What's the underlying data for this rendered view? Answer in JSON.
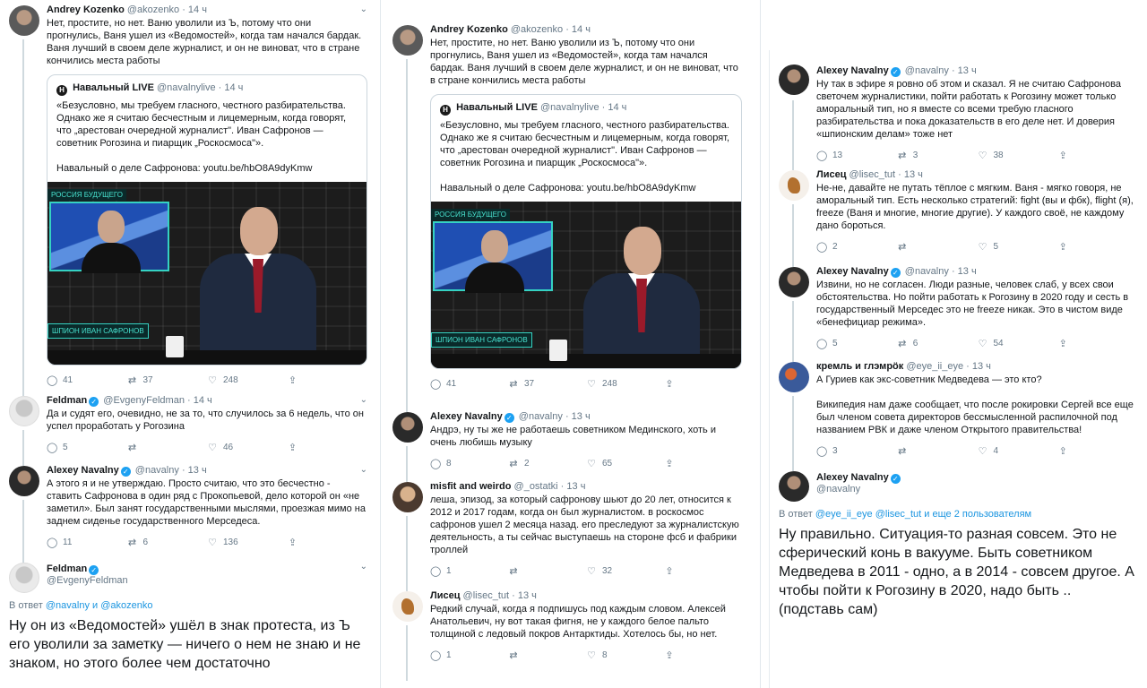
{
  "col1": {
    "t1": {
      "name": "Andrey Kozenko",
      "handle": "@akozenko",
      "time": "14 ч",
      "text": "Нет, простите, но нет. Ваню уволили из Ъ, потому что они прогнулись, Ваня ушел из «Ведомостей», когда там начался бардак. Ваня лучший в своем деле журналист, и он не виноват, что в стране кончились места работы",
      "quote": {
        "logo": "Н",
        "name": "Навальный LIVE",
        "handle": "@navalnylive",
        "time": "14 ч",
        "text": "«Безусловно, мы требуем гласного, честного разбирательства. Однако же я считаю бесчестным и лицемерным, когда говорят, что „арестован очередной журналист\". Иван Сафронов — советник Рогозина и пиарщик „Роскосмоса\"».\n\nНавальный о деле Сафронова: youtu.be/hbO8A9dyKmw",
        "img_tag": "РОССИЯ БУДУЩЕГО",
        "img_caption": "ШПИОН ИВАН САФРОНОВ"
      },
      "replies": "41",
      "retweets": "37",
      "likes": "248"
    },
    "t2": {
      "name": "Feldman",
      "handle": "@EvgenyFeldman",
      "time": "14 ч",
      "text": "Да и судят его, очевидно, не за то, что случилось за 6 недель, что он успел проработать у Рогозина",
      "replies": "5",
      "retweets": "",
      "likes": "46"
    },
    "t3": {
      "name": "Alexey Navalny",
      "handle": "@navalny",
      "time": "13 ч",
      "text": "А этого я и не утверждаю. Просто считаю, что это бесчестно - ставить Сафронова в один ряд с Прокопьевой, дело которой он «не заметил». Был занят государственными мыслями, проезжая мимо на заднем сиденье государственного Мерседеса.",
      "replies": "11",
      "retweets": "6",
      "likes": "136"
    },
    "t4": {
      "name": "Feldman",
      "handle": "@EvgenyFeldman",
      "reply_prefix": "В ответ",
      "reply_to": "@navalny и @akozenko",
      "text": "Ну он из «Ведомостей» ушёл в знак протеста, из Ъ его уволили за заметку — ничего о нем не знаю и не знаком, но этого более чем достаточно"
    }
  },
  "col2": {
    "t1": {
      "name": "Andrey Kozenko",
      "handle": "@akozenko",
      "time": "14 ч",
      "text": "Нет, простите, но нет. Ваню уволили из Ъ, потому что они прогнулись, Ваня ушел из «Ведомостей», когда там начался бардак. Ваня лучший в своем деле журналист, и он не виноват, что в стране кончились места работы",
      "quote": {
        "logo": "Н",
        "name": "Навальный LIVE",
        "handle": "@navalnylive",
        "time": "14 ч",
        "text": "«Безусловно, мы требуем гласного, честного разбирательства. Однако же я считаю бесчестным и лицемерным, когда говорят, что „арестован очередной журналист\". Иван Сафронов — советник Рогозина и пиарщик „Роскосмоса\"».\n\nНавальный о деле Сафронова: youtu.be/hbO8A9dyKmw",
        "img_tag": "РОССИЯ БУДУЩЕГО",
        "img_caption": "ШПИОН ИВАН САФРОНОВ"
      },
      "replies": "41",
      "retweets": "37",
      "likes": "248"
    },
    "t2": {
      "name": "Alexey Navalny",
      "handle": "@navalny",
      "time": "13 ч",
      "text": "Андрэ, ну ты же не работаешь советником Мединского, хоть и очень любишь музыку",
      "replies": "8",
      "retweets": "2",
      "likes": "65"
    },
    "t3": {
      "name": "misfit and weirdo",
      "handle": "@_ostatki",
      "time": "13 ч",
      "text": "леша, эпизод, за который сафронову шьют до 20 лет, относится к 2012 и 2017 годам, когда он был журналистом. в роскосмос сафронов ушел 2 месяца назад. его преследуют за журналистскую деятельность, а ты сейчас выступаешь на стороне фсб и фабрики троллей",
      "replies": "1",
      "retweets": "",
      "likes": "32"
    },
    "t4": {
      "name": "Лисец",
      "handle": "@lisec_tut",
      "time": "13 ч",
      "text": "Редкий случай, когда я подпишусь под каждым словом. Алексей Анатольевич, ну вот такая фигня, не у каждого белое пальто толщиной с ледовый покров Антарктиды. Хотелось бы, но нет.",
      "replies": "1",
      "retweets": "",
      "likes": "8"
    }
  },
  "col3": {
    "t1": {
      "name": "Alexey Navalny",
      "handle": "@navalny",
      "time": "13 ч",
      "text": "Ну так в эфире я ровно об этом и сказал. Я не считаю Сафронова светочем журналистики, пойти работать к Рогозину может только аморальный тип, но я вместе со всеми требую гласного разбирательства и пока доказательств в его деле нет. И доверия «шпионским делам» тоже нет",
      "replies": "13",
      "retweets": "3",
      "likes": "38"
    },
    "t2": {
      "name": "Лисец",
      "handle": "@lisec_tut",
      "time": "13 ч",
      "text": "Не-не, давайте не путать тёплое с мягким. Ваня - мягко говоря, не аморальный тип. Есть несколько стратегий: fight (вы и фбк), flight (я), freeze (Ваня и многие, многие другие). У каждого своё, не каждому дано бороться.",
      "replies": "2",
      "retweets": "",
      "likes": "5"
    },
    "t3": {
      "name": "Alexey Navalny",
      "handle": "@navalny",
      "time": "13 ч",
      "text": "Извини, но не согласен. Люди разные, человек слаб, у всех свои обстоятельства. Но пойти работать к Рогозину в 2020 году и сесть в государственный Мерседес это не freeze никак. Это в чистом виде «бенефициар режима».",
      "replies": "5",
      "retweets": "6",
      "likes": "54"
    },
    "t4": {
      "name": "кремль и глэмрöк",
      "handle": "@eye_ii_eye",
      "time": "13 ч",
      "text": "А Гуриев как экс-советник Медведева — это кто?\n\nВикипедия нам даже сообщает, что после рокировки Сергей все еще был членом совета директоров бессмысленной распилочной под названием РВК и даже членом Открытого правительства!",
      "replies": "3",
      "retweets": "",
      "likes": "4"
    },
    "t5": {
      "name": "Alexey Navalny",
      "handle": "@navalny",
      "reply_prefix": "В ответ",
      "reply_to": "@eye_ii_eye @lisec_tut и еще 2 пользователям",
      "text": "Ну правильно. Ситуация-то разная совсем. Это не сферический конь в вакууме. Быть советником Медведева в 2011 - одно, а в 2014 - совсем другое. А чтобы пойти к Рогозину в 2020, надо быть .. (подставь сам)"
    }
  },
  "icons": {
    "reply": "reply-icon",
    "retweet": "retweet-icon",
    "like": "like-icon",
    "share": "share-icon",
    "verified": "verified-icon",
    "chevron": "chevron-down-icon"
  },
  "colors": {
    "link": "#1b95e0",
    "verified": "#1da1f2",
    "muted": "#657786"
  }
}
